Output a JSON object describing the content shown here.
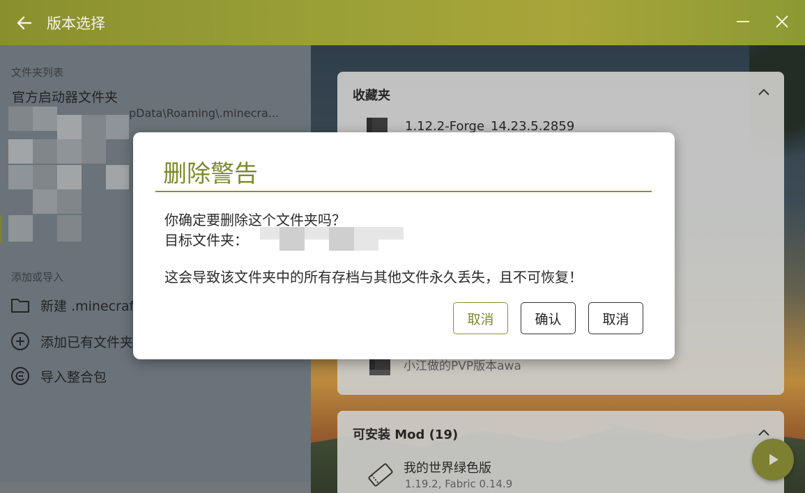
{
  "titlebar": {
    "title": "版本选择",
    "back_icon": "arrow-left-icon",
    "minimize_icon": "minimize-icon",
    "close_icon": "close-icon"
  },
  "sidebar": {
    "folders_heading": "文件夹列表",
    "folder": {
      "name": "官方启动器文件夹",
      "path": "pData\\Roaming\\.minecra..."
    },
    "add_heading": "添加或导入",
    "items": [
      {
        "label": "新建 .minecraft",
        "icon": "folder-icon"
      },
      {
        "label": "添加已有文件夹",
        "icon": "plus-circle-icon"
      },
      {
        "label": "导入整合包",
        "icon": "import-icon"
      }
    ]
  },
  "favorites": {
    "title": "收藏夹",
    "items": [
      {
        "name": "1.12.2-Forge_14.23.5.2859"
      },
      {
        "name": "小江做的PVP版本awa"
      }
    ]
  },
  "mods": {
    "title": "可安装 Mod (19)",
    "items": [
      {
        "name": "我的世界绿色版",
        "sub": "1.19.2, Fabric 0.14.9"
      }
    ]
  },
  "dialog": {
    "title": "删除警告",
    "line1": "你确定要删除这个文件夹吗？",
    "line2": "目标文件夹：",
    "line3": "这会导致该文件夹中的所有存档与其他文件永久丢失，且不可恢复！",
    "buttons": {
      "cancel_accent": "取消",
      "confirm": "确认",
      "cancel": "取消"
    }
  },
  "colors": {
    "accent": "#8a8f2e",
    "dialog_title": "#7d8a2a"
  }
}
